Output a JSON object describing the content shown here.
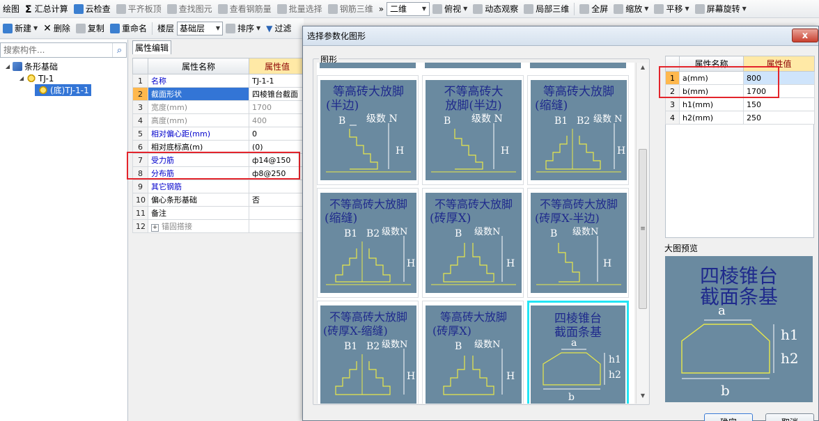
{
  "toolbar1": {
    "draw": "绘图",
    "summary": "汇总计算",
    "cloud_check": "云检查",
    "align_slab": "平齐板顶",
    "find_elem": "查找图元",
    "view_rebar": "查看钢筋量",
    "batch_select": "批量选择",
    "rebar_3d": "钢筋三维",
    "more": "»",
    "view_mode": "二维",
    "top_view": "俯视",
    "dynamic_view": "动态观察",
    "local_3d": "局部三维",
    "fullscreen": "全屏",
    "zoom": "缩放",
    "pan": "平移",
    "screen_rotate": "屏幕旋转"
  },
  "toolbar2": {
    "new": "新建",
    "delete": "删除",
    "copy": "复制",
    "rename": "重命名",
    "floor_label": "楼层",
    "floor_value": "基础层",
    "sort": "排序",
    "filter": "过滤"
  },
  "left": {
    "search_placeholder": "搜索构件...",
    "tree": [
      {
        "label": "条形基础"
      },
      {
        "label": "TJ-1"
      },
      {
        "label": "(底)TJ-1-1"
      }
    ]
  },
  "props": {
    "tab": "属性编辑",
    "col_name": "属性名称",
    "col_value": "属性值",
    "rows": [
      {
        "n": "1",
        "name": "名称",
        "value": "TJ-1-1"
      },
      {
        "n": "2",
        "name": "截面形状",
        "value": "四棱锥台截面"
      },
      {
        "n": "3",
        "name": "宽度(mm)",
        "value": "1700"
      },
      {
        "n": "4",
        "name": "高度(mm)",
        "value": "400"
      },
      {
        "n": "5",
        "name": "相对偏心距(mm)",
        "value": "0"
      },
      {
        "n": "6",
        "name": "相对底标高(m)",
        "value": "(0)"
      },
      {
        "n": "7",
        "name": "受力筋",
        "value": "ф14@150"
      },
      {
        "n": "8",
        "name": "分布筋",
        "value": "ф8@250"
      },
      {
        "n": "9",
        "name": "其它钢筋",
        "value": ""
      },
      {
        "n": "10",
        "name": "偏心条形基础",
        "value": "否"
      },
      {
        "n": "11",
        "name": "备注",
        "value": ""
      },
      {
        "n": "12",
        "name": "锚固搭接",
        "value": "",
        "expander": "+"
      }
    ]
  },
  "dialog": {
    "title": "选择参数化图形",
    "close": "x",
    "group_label": "图形",
    "shapes": [
      {
        "l1": "等高砖大放脚",
        "l2": "(半边)",
        "b": "B",
        "b2": "",
        "n": "级数 N",
        "h": "H"
      },
      {
        "l1": "不等高砖大",
        "l2": "放脚(半边)",
        "b": "B",
        "b2": "",
        "n": "级数 N",
        "h": "H"
      },
      {
        "l1": "等高砖大放脚",
        "l2": "(缩缝)",
        "b": "B1",
        "b2": "B2",
        "n": "级数 N",
        "h": "H"
      },
      {
        "l1": "不等高砖大放脚",
        "l2": "(缩缝)",
        "b": "B1",
        "b2": "B2",
        "n": "级数N",
        "h": "H"
      },
      {
        "l1": "不等高砖大放脚",
        "l2": "(砖厚X)",
        "b": "B",
        "b2": "",
        "n": "级数N",
        "h": "H"
      },
      {
        "l1": "不等高砖大放脚",
        "l2": "(砖厚X-半边)",
        "b": "B",
        "b2": "",
        "n": "级数N",
        "h": "H"
      },
      {
        "l1": "不等高砖大放脚",
        "l2": "(砖厚X-缩缝)",
        "b": "B1",
        "b2": "B2",
        "n": "级数N",
        "h": "H"
      },
      {
        "l1": "等高砖大放脚",
        "l2": "(砖厚X)",
        "b": "B",
        "b2": "",
        "n": "级数N",
        "h": "H"
      },
      {
        "l1": "四棱锥台",
        "l2": "截面条基",
        "a": "a",
        "h1": "h1",
        "h2": "h2",
        "bb": "b"
      }
    ],
    "param_table": {
      "col_name": "属性名称",
      "col_value": "属性值",
      "rows": [
        {
          "n": "1",
          "name": "a(mm)",
          "value": "800"
        },
        {
          "n": "2",
          "name": "b(mm)",
          "value": "1700"
        },
        {
          "n": "3",
          "name": "h1(mm)",
          "value": "150"
        },
        {
          "n": "4",
          "name": "h2(mm)",
          "value": "250"
        }
      ]
    },
    "preview_label": "大图预览",
    "preview": {
      "l1": "四棱锥台",
      "l2": "截面条基",
      "a": "a",
      "h1": "h1",
      "h2": "h2",
      "b": "b"
    },
    "ok": "确定",
    "cancel": "取消"
  },
  "colors": {
    "shape_bg": "#6a8aa0",
    "shape_text": "#1f2a8c",
    "shape_line": "#e8e84a",
    "highlight_red": "#e3242b",
    "selected_border": "#22e5f5"
  }
}
